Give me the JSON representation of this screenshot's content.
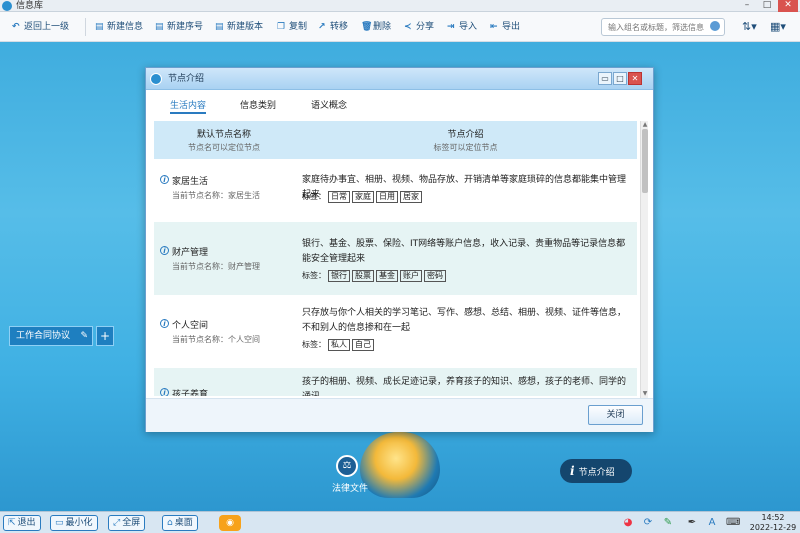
{
  "window": {
    "title": "信息库"
  },
  "toolbar": {
    "back": "返回上一级",
    "new_info": "新建信息",
    "new_serial": "新建序号",
    "new_version": "新建版本",
    "copy": "复制",
    "move": "转移",
    "delete": "删除",
    "share": "分享",
    "import": "导入",
    "export": "导出",
    "search_placeholder": "输入组名或标题，筛选信息"
  },
  "side_tab": {
    "label": "工作合同协议",
    "plus": "+"
  },
  "dialog": {
    "title": "节点介绍",
    "tabs": [
      "生活内容",
      "信息类别",
      "语义概念"
    ],
    "header": {
      "col1": "默认节点名称",
      "col1_sub": "节点名可以定位节点",
      "col2": "节点介绍",
      "col2_sub": "标签可以定位节点"
    },
    "tags_label": "标签：",
    "rows": [
      {
        "name": "家居生活",
        "current": "当前节点名称：家居生活",
        "desc": "家庭待办事宜、相册、视频、物品存放、开销清单等家庭琐碎的信息都能集中管理起来",
        "tags": [
          "日常",
          "家庭",
          "日用",
          "居家"
        ]
      },
      {
        "name": "财产管理",
        "current": "当前节点名称：财产管理",
        "desc": "银行、基金、股票、保险、IT网络等账户信息，收入记录、贵重物品等记录信息都能安全管理起来",
        "tags": [
          "银行",
          "股票",
          "基金",
          "账户",
          "密码"
        ]
      },
      {
        "name": "个人空间",
        "current": "当前节点名称：个人空间",
        "desc": "只存放与你个人相关的学习笔记、写作、感想、总结、相册、视频、证件等信息，不和别人的信息掺和在一起",
        "tags": [
          "私人",
          "自己"
        ]
      },
      {
        "name": "孩子养育",
        "current": "",
        "desc": "孩子的相册、视频、成长足迹记录，养育孩子的知识、感想，孩子的老师、同学的通讯",
        "tags": []
      }
    ],
    "close_button": "关闭"
  },
  "desktop": {
    "law_label": "法律文件",
    "node_intro": "节点介绍"
  },
  "taskbar": {
    "exit": "退出",
    "minimize": "最小化",
    "fullscreen": "全屏",
    "desktop": "桌面",
    "time": "14:52",
    "date": "2022-12-29",
    "lang": "A"
  }
}
